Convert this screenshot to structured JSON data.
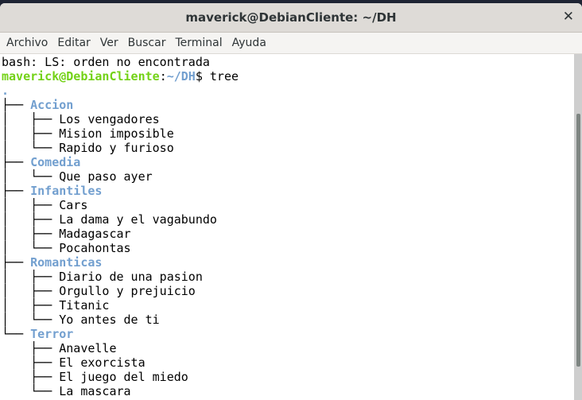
{
  "window": {
    "title": "maverick@DebianCliente: ~/DH"
  },
  "menu": [
    "Archivo",
    "Editar",
    "Ver",
    "Buscar",
    "Terminal",
    "Ayuda"
  ],
  "terminal": {
    "error_line": "bash: LS: orden no encontrada",
    "prompt": {
      "user_host": "maverick@DebianCliente",
      "sep": ":",
      "path": "~/DH",
      "symbol": "$ ",
      "command": "tree"
    },
    "root": ".",
    "tree": [
      {
        "prefix": "├── ",
        "name": "Accion",
        "dir": true
      },
      {
        "prefix": "│   ├── ",
        "name": "Los vengadores"
      },
      {
        "prefix": "│   ├── ",
        "name": "Mision imposible"
      },
      {
        "prefix": "│   └── ",
        "name": "Rapido y furioso"
      },
      {
        "prefix": "├── ",
        "name": "Comedia",
        "dir": true
      },
      {
        "prefix": "│   └── ",
        "name": "Que paso ayer"
      },
      {
        "prefix": "├── ",
        "name": "Infantiles",
        "dir": true
      },
      {
        "prefix": "│   ├── ",
        "name": "Cars"
      },
      {
        "prefix": "│   ├── ",
        "name": "La dama y el vagabundo"
      },
      {
        "prefix": "│   ├── ",
        "name": "Madagascar"
      },
      {
        "prefix": "│   └── ",
        "name": "Pocahontas"
      },
      {
        "prefix": "├── ",
        "name": "Romanticas",
        "dir": true
      },
      {
        "prefix": "│   ├── ",
        "name": "Diario de una pasion"
      },
      {
        "prefix": "│   ├── ",
        "name": "Orgullo y prejuicio"
      },
      {
        "prefix": "│   ├── ",
        "name": "Titanic"
      },
      {
        "prefix": "│   └── ",
        "name": "Yo antes de ti"
      },
      {
        "prefix": "└── ",
        "name": "Terror",
        "dir": true
      },
      {
        "prefix": "    ├── ",
        "name": "Anavelle"
      },
      {
        "prefix": "    ├── ",
        "name": "El exorcista"
      },
      {
        "prefix": "    ├── ",
        "name": "El juego del miedo"
      },
      {
        "prefix": "    └── ",
        "name": "La mascara"
      }
    ]
  },
  "colors": {
    "prompt_user": "#73d216",
    "prompt_path": "#729fcf",
    "directory": "#729fcf"
  },
  "icons": {
    "close": "close-icon"
  },
  "scrollbar": {
    "position_fraction": 0.83
  }
}
